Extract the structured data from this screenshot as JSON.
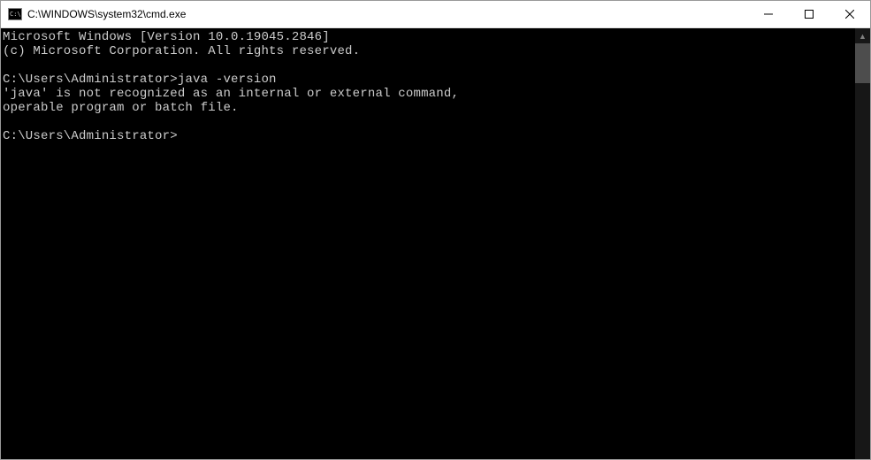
{
  "window": {
    "title": "C:\\WINDOWS\\system32\\cmd.exe",
    "icon_label": "C:\\"
  },
  "terminal": {
    "banner_line1": "Microsoft Windows [Version 10.0.19045.2846]",
    "banner_line2": "(c) Microsoft Corporation. All rights reserved.",
    "prompt1": "C:\\Users\\Administrator>",
    "command1": "java -version",
    "error_line1": "'java' is not recognized as an internal or external command,",
    "error_line2": "operable program or batch file.",
    "prompt2": "C:\\Users\\Administrator>"
  }
}
